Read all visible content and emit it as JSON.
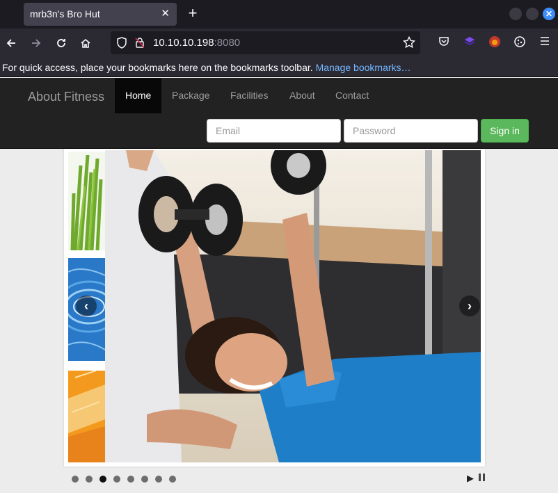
{
  "browser": {
    "tab_title": "mrb3n's Bro Hut",
    "tab_close": "✕",
    "new_tab": "+",
    "url_host": "10.10.10.198",
    "url_port": ":8080",
    "bookmarks_text": "For quick access, place your bookmarks here on the bookmarks toolbar.",
    "bookmarks_link": "Manage bookmarks…"
  },
  "site": {
    "brand": "About Fitness",
    "nav": [
      "Home",
      "Package",
      "Facilities",
      "About",
      "Contact"
    ],
    "active_nav": "Home",
    "email_placeholder": "Email",
    "password_placeholder": "Password",
    "signin_label": "Sign in"
  },
  "carousel": {
    "prev_label": "‹",
    "next_label": "›",
    "dot_count": 8,
    "active_dot": 3,
    "play_label": "▶"
  },
  "colors": {
    "navbar_bg": "#222222",
    "signin_green": "#5cb85c",
    "link_blue": "#75b8ff"
  }
}
